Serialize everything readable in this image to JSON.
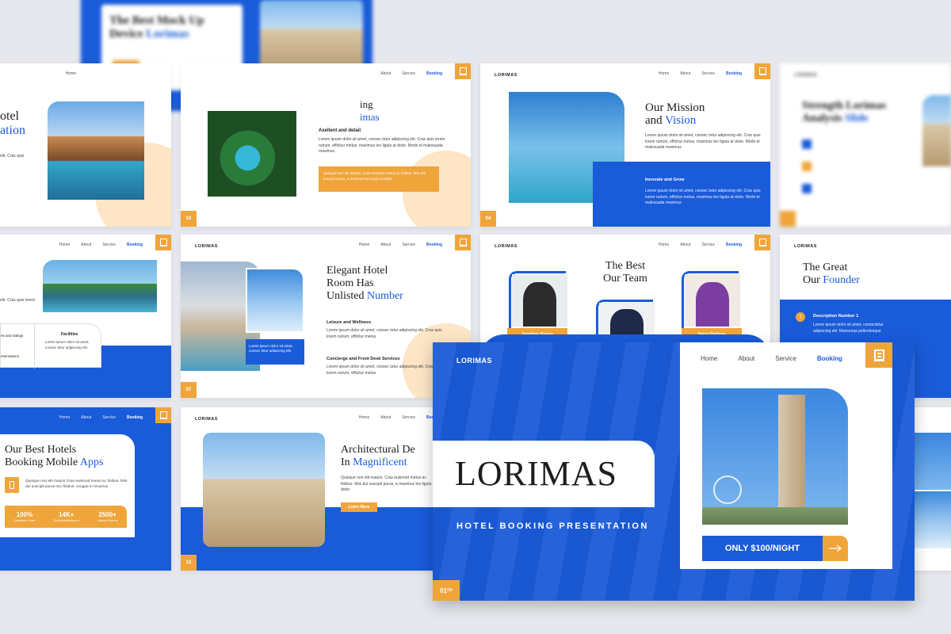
{
  "brand": "LORIMAS",
  "nav": [
    "Home",
    "About",
    "Service",
    "Booking"
  ],
  "slides": {
    "top_blur": {
      "title_a": "The Best Mock Up",
      "title_b": "Device ",
      "title_blue": "Lorimas"
    },
    "hotel_left": {
      "title_a": "otel",
      "title_blue": "ation",
      "para": "elit. Cras quis"
    },
    "exploring": {
      "title_a": "ing",
      "title_blue": "imas",
      "sub": "Axellent and detail",
      "para": "Lorem ipsum dolor sit amet, consec tetur adipiscing elit. Cras quis lorem rutrum, efficitur metus. maximus leo ligula at dolor. Morbi et malesuada maximus.",
      "box": "Quisque non elit mauris. Cras euismod metus ac finibus. felis dui suscipit purus, a maximus leo ligula at dolor.",
      "page": "03"
    },
    "mission": {
      "title_a": "Our Mission",
      "title_b": "and ",
      "title_blue": "Vision",
      "para": "Lorem ipsum dolor sit amet, consec tetur adipiscing elit. Cras quis lorem rutrum, efficitur metus. maximus leo ligula at dolor. Morbi et malesuada maximus",
      "box_title": "Innovate and Grow",
      "box_para": "Lorem ipsum dolor sit amet, consec tetur adipiscing elit. Cras quis lorem rutrum, efficitur metus. maximus leo ligula at dolor. Morbi et malesuada maximus",
      "page": "04"
    },
    "strength": {
      "title_a": "Strength Lorimas",
      "title_b": "Analysis ",
      "title_blue": "Slide"
    },
    "facilities": {
      "para": "elit. Cras quis lorem",
      "col1": "es and ratings",
      "col1b": "eservations",
      "col2_title": "Facilities",
      "col2_para": "Lorem ipsum dolor sit amet, consec tetur adipiscing elit."
    },
    "elegant": {
      "title_a": "Elegant Hotel",
      "title_b": "Room Has",
      "title_c": "Unlisted ",
      "title_blue": "Number",
      "sub1": "Leisure and Wellness",
      "para1": "Lorem ipsum dolor sit amet, consec tetur adipiscing elit. Cras quis lorem rutrum, efficitur metus.",
      "sub2": "Concierge and Front Desk Services",
      "para2": "Lorem ipsum dolor sit amet, consec tetur adipiscing elit. Cras quis lorem rutrum, efficitur metus.",
      "caption": "Lorem ipsum dolor sit amet, consec tetur adipiscing elit.",
      "page": "07"
    },
    "team": {
      "title_a": "The Best",
      "title_b": "Our Team",
      "members": [
        "Jonathan Breeze",
        "",
        "Darco Pedresa"
      ]
    },
    "founder": {
      "title_a": "The Great",
      "title_b": "Our ",
      "title_blue": "Founder",
      "desc_title": "Description Number 1",
      "desc_para": "Lorem ipsum dolor sit amet, consectetur adipiscing elit. Maecenas pellentesque"
    },
    "apps": {
      "title_a": "Our Best Hotels",
      "title_b": "Booking Mobile ",
      "title_blue": "Apps",
      "para": "Quisque non elit mauris Cras euismod metus ac finibus. felis dui suscipit purus nec finibus. congue in Vivamus",
      "stats": [
        {
          "v": "100%",
          "l": "Customer Care"
        },
        {
          "v": "14K+",
          "l": "Total Achievement"
        },
        {
          "v": "2500+",
          "l": "Luxury Rooms"
        }
      ]
    },
    "arch": {
      "title_a": "Architectural De",
      "title_b": "In ",
      "title_blue": "Magnificent",
      "para": "Quisque non elit mauris. Cras euismod metus ac finibus. felis dui suscipit purus, a maximus leo ligula at dolor.",
      "button": "Learn More",
      "page": "13"
    },
    "cover": {
      "brand": "LORIMAS",
      "title": "LORIMAS",
      "subtitle": "HOTEL BOOKING PRESENTATION",
      "cta": "ONLY $100/NIGHT",
      "page": "01",
      "page_total": "/10"
    }
  },
  "colors": {
    "blue": "#1a5bd9",
    "orange": "#f0a53a"
  },
  "icons": [
    "building-icon",
    "arrow-right-icon",
    "phone-icon"
  ]
}
